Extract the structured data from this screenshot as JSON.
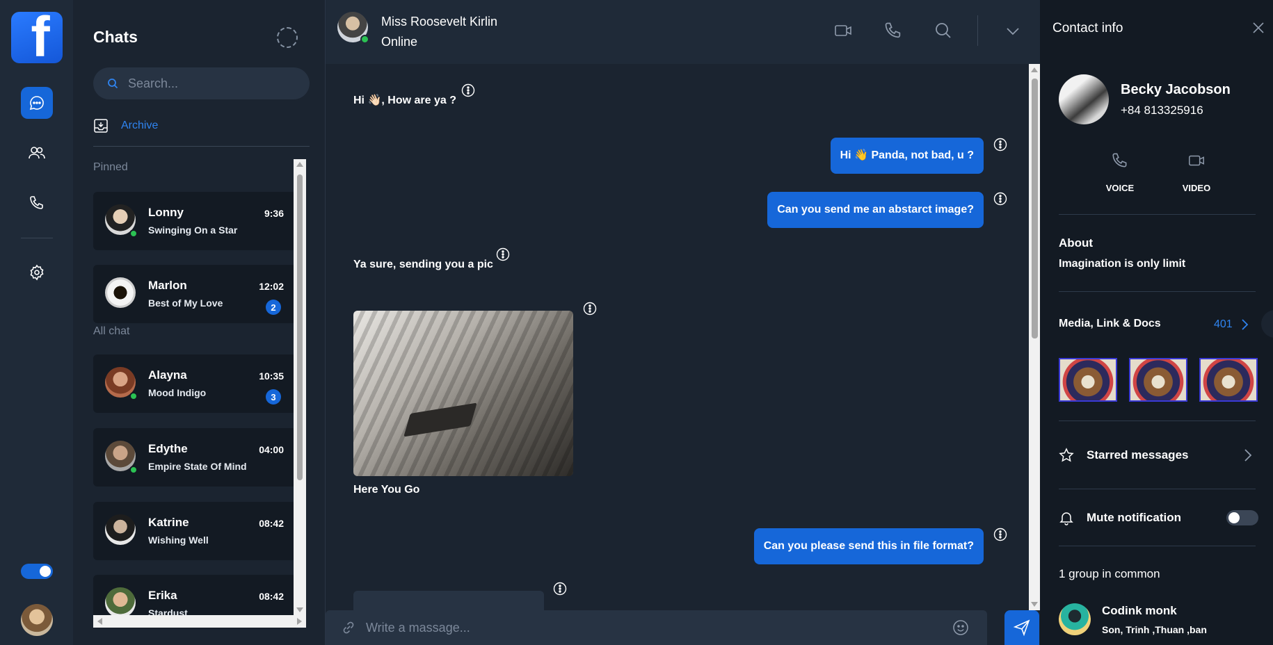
{
  "app": {
    "logo_letter": "f"
  },
  "chats_panel": {
    "title": "Chats",
    "search_placeholder": "Search...",
    "archive_label": "Archive",
    "pinned_label": "Pinned",
    "all_chat_label": "All chat",
    "items": [
      {
        "name": "Lonny",
        "message": "Swinging On a Star",
        "time": "9:36",
        "badge": "",
        "online": true
      },
      {
        "name": "Marlon",
        "message": "Best of My Love",
        "time": "12:02",
        "badge": "2",
        "online": false
      },
      {
        "name": "Alayna",
        "message": "Mood Indigo",
        "time": "10:35",
        "badge": "3",
        "online": true
      },
      {
        "name": "Edythe",
        "message": "Empire State Of Mind",
        "time": "04:00",
        "badge": "",
        "online": true
      },
      {
        "name": "Katrine",
        "message": "Wishing Well",
        "time": "08:42",
        "badge": "",
        "online": false
      },
      {
        "name": "Erika",
        "message": "Stardust",
        "time": "08:42",
        "badge": "",
        "online": false
      }
    ]
  },
  "conversation": {
    "contact_name": "Miss Roosevelt Kirlin",
    "status": "Online",
    "messages": [
      {
        "direction": "in",
        "text": "Hi 👋🏻, How are ya ?"
      },
      {
        "direction": "out",
        "text": "Hi 👋 Panda, not bad, u ?"
      },
      {
        "direction": "out",
        "text": "Can you send me an abstarct image?"
      },
      {
        "direction": "in",
        "text": "Ya sure, sending you a pic"
      },
      {
        "direction": "in",
        "type": "image",
        "caption": "Here You Go"
      },
      {
        "direction": "out",
        "text": "Can you please send this in file format?"
      }
    ],
    "composer_placeholder": "Write a massage..."
  },
  "contact_info": {
    "title": "Contact info",
    "name": "Becky Jacobson",
    "phone": "+84 813325916",
    "voice_label": "VOICE",
    "video_label": "VIDEO",
    "about_heading": "About",
    "about_text": "Imagination is only limit",
    "media_heading": "Media, Link & Docs",
    "media_count": "401",
    "starred_label": "Starred messages",
    "mute_label": "Mute notification",
    "mute_enabled": false,
    "groups_heading": "1 group in common",
    "group": {
      "name": "Codink monk",
      "members": "Son, Trinh ,Thuan ,ban"
    }
  },
  "colors": {
    "accent": "#1667d9",
    "online": "#2bc253",
    "link": "#2f84f0"
  }
}
